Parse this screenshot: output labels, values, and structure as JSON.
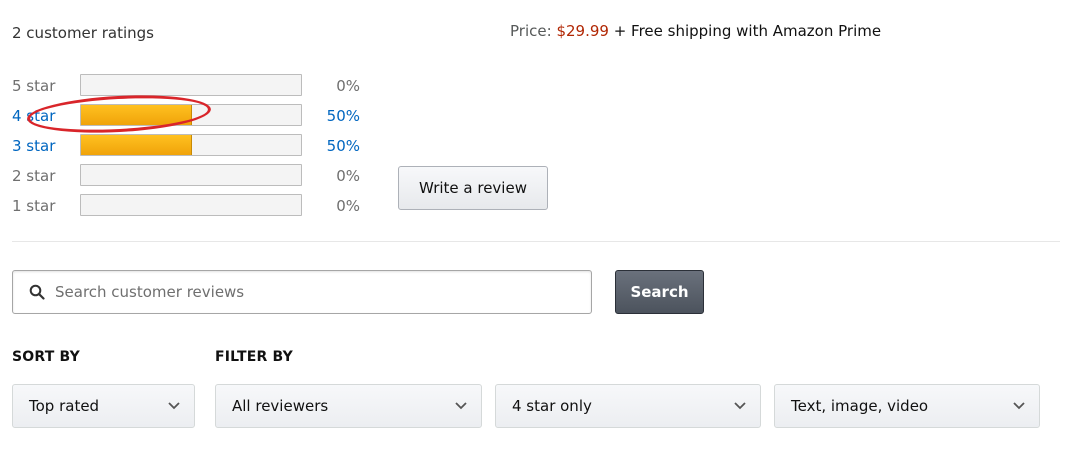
{
  "summary": {
    "ratings_count": "2 customer ratings"
  },
  "price": {
    "label": "Price:",
    "value": "$29.99",
    "shipping": "+ Free shipping with Amazon Prime",
    "value_color": "#B12704"
  },
  "histogram": [
    {
      "label": "5 star",
      "percent_text": "0%",
      "percent": 0
    },
    {
      "label": "4 star",
      "percent_text": "50%",
      "percent": 50
    },
    {
      "label": "3 star",
      "percent_text": "50%",
      "percent": 50
    },
    {
      "label": "2 star",
      "percent_text": "0%",
      "percent": 0
    },
    {
      "label": "1 star",
      "percent_text": "0%",
      "percent": 0
    }
  ],
  "annotation": {
    "highlight_color": "#d9252a",
    "highlighted_row": "4 star"
  },
  "actions": {
    "write_review_label": "Write a review"
  },
  "search": {
    "placeholder": "Search customer reviews",
    "value": "",
    "button_label": "Search",
    "icon": "search-icon"
  },
  "sort": {
    "label": "SORT BY",
    "selected": "Top rated"
  },
  "filter": {
    "label": "FILTER BY",
    "reviewers_selected": "All reviewers",
    "stars_selected": "4 star only",
    "format_selected": "Text, image, video"
  },
  "colors": {
    "bar_fill": "#f6a508",
    "link": "#0066c0",
    "search_button": "#4c535d"
  }
}
